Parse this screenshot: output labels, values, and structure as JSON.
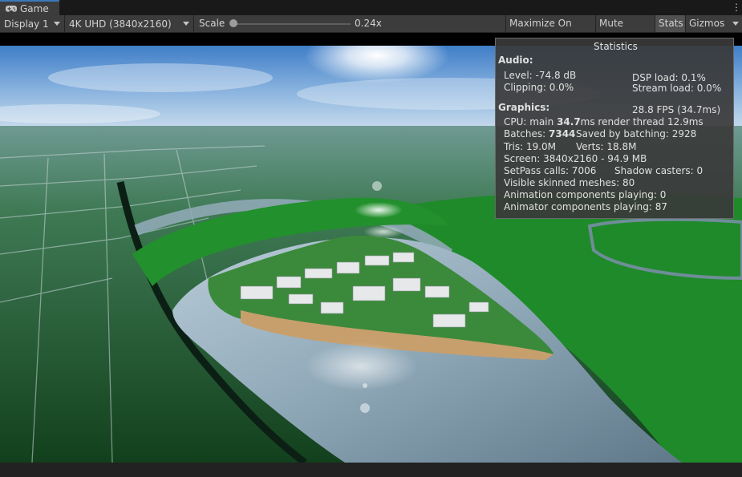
{
  "window": {
    "tab_label": "Game",
    "tab_icon": "gamepad-icon"
  },
  "toolbar": {
    "display_select": "Display 1",
    "resolution_select": "4K UHD (3840x2160)",
    "scale_label": "Scale",
    "scale_value": "0.24x",
    "scale_slider_position": 0.0,
    "maximize_on_play": "Maximize On Play",
    "mute_audio": "Mute Audio",
    "stats": "Stats",
    "gizmos": "Gizmos"
  },
  "statistics": {
    "title": "Statistics",
    "audio_header": "Audio:",
    "level": "Level: -74.8 dB",
    "dsp_load": "DSP load: 0.1%",
    "clipping": "Clipping: 0.0%",
    "stream_load": "Stream load: 0.0%",
    "graphics_header": "Graphics:",
    "fps": "28.8 FPS (34.7ms)",
    "cpu_prefix": "CPU: main ",
    "cpu_main": "34.7",
    "cpu_suffix": "ms  render thread 12.9ms",
    "batches_prefix": "Batches: ",
    "batches": "7344",
    "saved_batching": "Saved by batching: 2928",
    "tris": "Tris: 19.0M",
    "verts": "Verts: 18.8M",
    "screen": "Screen: 3840x2160 - 94.9 MB",
    "setpass": "SetPass calls: 7006",
    "shadow_casters": "Shadow casters: 0",
    "skinned_meshes": "Visible skinned meshes: 80",
    "animation_components": "Animation components playing: 0",
    "animator_components": "Animator components playing: 87"
  },
  "colors": {
    "editor_bg": "#3c3c3c",
    "tab_accent": "#3a79bb",
    "grass": "#1f8a2a",
    "water": "#9fb6c4"
  }
}
